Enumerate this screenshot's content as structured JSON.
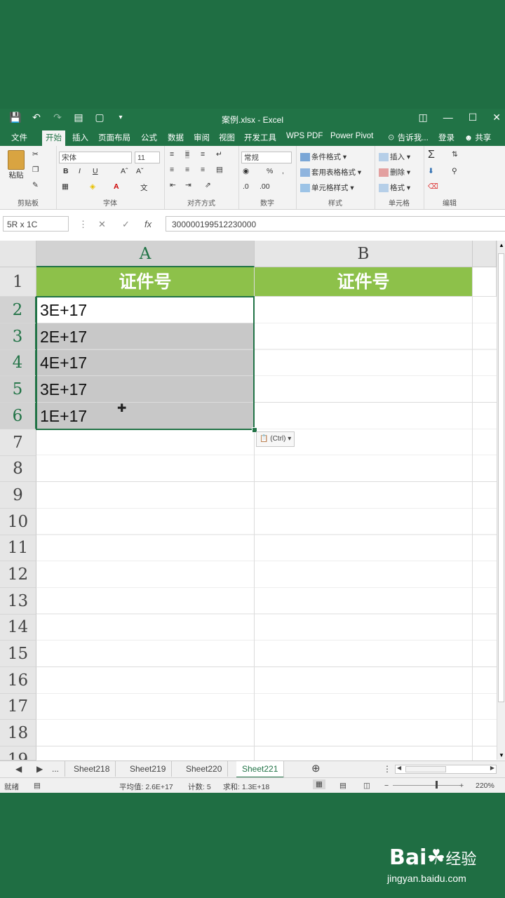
{
  "window": {
    "title": "案例.xlsx - Excel",
    "qat_icons": [
      "save-icon",
      "undo-icon",
      "redo-icon",
      "form-icon",
      "preview-icon",
      "customize-icon"
    ]
  },
  "ribbon_tabs": [
    "文件",
    "开始",
    "插入",
    "页面布局",
    "公式",
    "数据",
    "审阅",
    "视图",
    "开发工具",
    "WPS PDF",
    "Power Pivot",
    "告诉我...",
    "登录",
    "共享"
  ],
  "ribbon": {
    "clipboard": {
      "paste": "粘贴",
      "label": "剪贴板"
    },
    "font": {
      "name": "宋体",
      "size": "11",
      "label": "字体",
      "bold": "B",
      "italic": "I",
      "underline": "U"
    },
    "alignment": {
      "label": "对齐方式"
    },
    "number": {
      "format": "常规",
      "label": "数字"
    },
    "styles": {
      "cond": "条件格式",
      "table": "套用表格格式",
      "cell": "单元格样式",
      "label": "样式"
    },
    "cells": {
      "insert": "插入",
      "delete": "删除",
      "format": "格式",
      "label": "单元格"
    },
    "editing": {
      "label": "编辑"
    }
  },
  "formula_bar": {
    "name_box": "5R x 1C",
    "value": "300000199512230000",
    "fx": "fx"
  },
  "columns": [
    "A",
    "B"
  ],
  "rows": [
    "1",
    "2",
    "3",
    "4",
    "5",
    "6",
    "7",
    "8",
    "9",
    "10",
    "11",
    "12",
    "13",
    "14",
    "15",
    "16",
    "17",
    "18",
    "19"
  ],
  "cells": {
    "A1": "证件号",
    "B1": "证件号",
    "A2": "3E+17",
    "A3": "2E+17",
    "A4": "4E+17",
    "A5": "3E+17",
    "A6": "1E+17"
  },
  "paste_options": "(Ctrl)",
  "sheets": [
    "...",
    "Sheet218",
    "Sheet219",
    "Sheet220",
    "Sheet221"
  ],
  "active_sheet": "Sheet221",
  "status": {
    "mode": "就绪",
    "average": "平均值: 2.6E+17",
    "count": "计数: 5",
    "sum": "求和: 1.3E+18",
    "zoom": "220%"
  },
  "watermark": {
    "brand": "Bai",
    "brand2": "经验",
    "url": "jingyan.baidu.com"
  },
  "colors": {
    "excel_green": "#217346",
    "header_fill": "#8dc14a",
    "selection_fill": "#c8c8c8"
  }
}
